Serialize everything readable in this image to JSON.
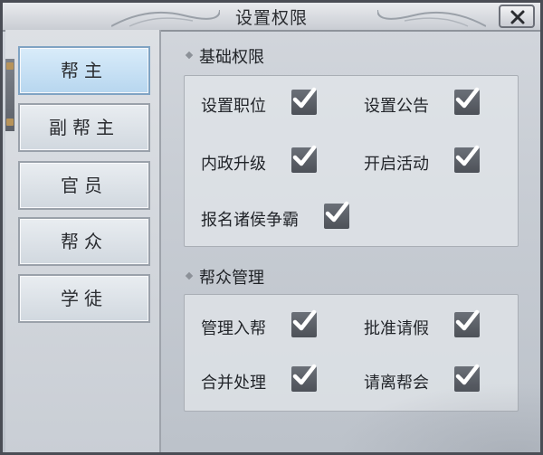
{
  "window": {
    "title": "设置权限",
    "close_icon": "close-icon"
  },
  "ranks": [
    {
      "label": "帮主",
      "active": true
    },
    {
      "label": "副帮主",
      "active": false
    },
    {
      "label": "官员",
      "active": false
    },
    {
      "label": "帮众",
      "active": false
    },
    {
      "label": "学徒",
      "active": false
    }
  ],
  "sections": [
    {
      "title": "基础权限",
      "permissions": [
        {
          "label": "设置职位",
          "checked": true
        },
        {
          "label": "设置公告",
          "checked": true
        },
        {
          "label": "内政升级",
          "checked": true
        },
        {
          "label": "开启活动",
          "checked": true
        },
        {
          "label": "报名诸侯争霸",
          "checked": true
        }
      ]
    },
    {
      "title": "帮众管理",
      "permissions": [
        {
          "label": "管理入帮",
          "checked": true
        },
        {
          "label": "批准请假",
          "checked": true
        },
        {
          "label": "合并处理",
          "checked": true
        },
        {
          "label": "请离帮会",
          "checked": true
        }
      ]
    }
  ],
  "colors": {
    "active_tab": "#b7d6ef",
    "checkbox": "#5c6068",
    "check": "#ffffff"
  }
}
